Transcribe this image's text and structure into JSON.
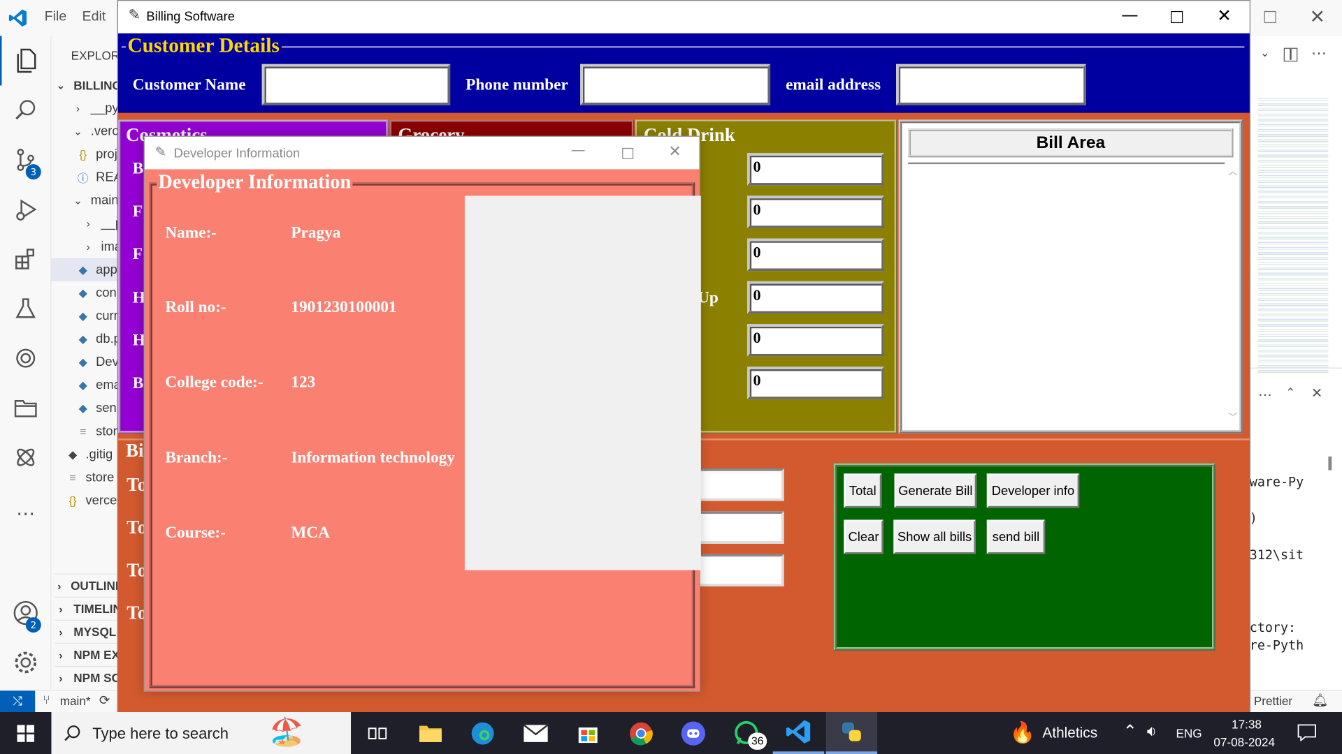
{
  "vscode": {
    "menu": [
      "File",
      "Edit"
    ],
    "explorer_title": "EXPLORER",
    "root_folder": "BILLING_",
    "tree": [
      {
        "label": "__pyc",
        "icon": "chevron-right-icon"
      },
      {
        "label": ".verce",
        "icon": "chevron-down-icon"
      },
      {
        "label": "proj",
        "icon": "json-braces-icon"
      },
      {
        "label": "REA",
        "icon": "info-icon"
      },
      {
        "label": "main",
        "icon": "chevron-down-icon"
      },
      {
        "label": "__py",
        "icon": "chevron-right-icon"
      },
      {
        "label": "ima",
        "icon": "chevron-right-icon"
      },
      {
        "label": "app",
        "icon": "python-file-icon"
      },
      {
        "label": "con",
        "icon": "python-file-icon"
      },
      {
        "label": "curr",
        "icon": "python-file-icon"
      },
      {
        "label": "db.p",
        "icon": "python-file-icon"
      },
      {
        "label": "Dev",
        "icon": "python-file-icon"
      },
      {
        "label": "ema",
        "icon": "python-file-icon"
      },
      {
        "label": "sen",
        "icon": "python-file-icon"
      },
      {
        "label": "stor",
        "icon": "text-file-icon"
      },
      {
        "label": ".gitig",
        "icon": "git-icon"
      },
      {
        "label": "store",
        "icon": "text-file-icon"
      },
      {
        "label": "verce",
        "icon": "json-braces-icon"
      }
    ],
    "sections": [
      "OUTLINE",
      "TIMELIN",
      "MYSQL",
      "NPM EX",
      "NPM SC"
    ],
    "activity_badges": {
      "source_control": "3",
      "accounts": "2"
    },
    "terminal_lines": [
      "ware-Py",
      ")",
      "312\\sit",
      "ctory:",
      "re-Pyth"
    ],
    "status": {
      "branch": "main*",
      "prettier": "Prettier"
    }
  },
  "billing": {
    "window_title": "Billing Software",
    "customer": {
      "legend": "Customer Details",
      "name_label": "Customer Name",
      "name_value": "",
      "phone_label": "Phone number",
      "phone_value": "",
      "email_label": "email address",
      "email_value": ""
    },
    "panels": {
      "cosmetics": "Cosmetics",
      "grocery": "Grocery",
      "cold_drink": "Cold Drink",
      "cosmetics_visible_initials": [
        "B",
        "F",
        "F",
        "H",
        "H",
        "B"
      ],
      "cold_drink_partial_label": "s Up",
      "cold_drink_values": [
        "0",
        "0",
        "0",
        "0",
        "0",
        "0"
      ]
    },
    "bill_area_title": "Bill Area",
    "bottom": {
      "legend_partial": "Bi",
      "row_initials": [
        "To",
        "To",
        "To",
        "To"
      ],
      "buttons": [
        "Total",
        "Generate Bill",
        "Developer info",
        "Clear",
        "Show all bills",
        "send bill"
      ]
    }
  },
  "developer_window": {
    "title": "Developer Information",
    "legend": "Developer Information",
    "rows": [
      {
        "label": "Name:-",
        "value": "Pragya"
      },
      {
        "label": "Roll no:-",
        "value": "1901230100001"
      },
      {
        "label": "College code:-",
        "value": "123"
      },
      {
        "label": "Branch:-",
        "value": "Information technology"
      },
      {
        "label": "Course:-",
        "value": "MCA"
      }
    ]
  },
  "taskbar": {
    "search_placeholder": "Type here to search",
    "whatsapp_badge": "36",
    "weather": "Athletics",
    "language": "ENG",
    "time": "17:38",
    "date": "07-08-2024"
  },
  "colors": {
    "customer_bg": "#0000a0",
    "cosmetics_bg": "#9400d3",
    "grocery_bg": "#8b0000",
    "cold_drink_bg": "#8b8000",
    "billing_bg": "#d35a2e",
    "buttons_bg": "#006400",
    "dev_bg": "#fa8072",
    "legend_text": "#ffd700"
  }
}
